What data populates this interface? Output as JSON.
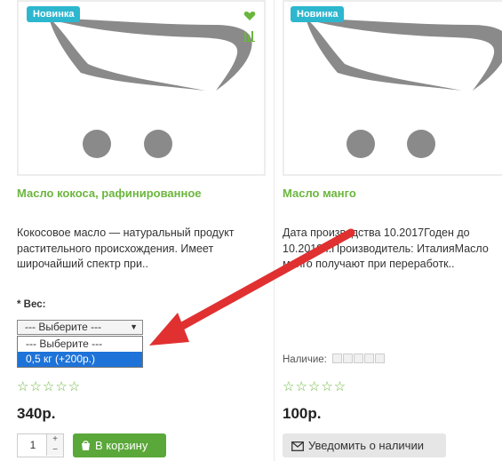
{
  "colors": {
    "accent": "#6bb63e",
    "badge": "#2db7cf",
    "cart_button": "#5aa839",
    "select_highlight": "#1e73d8",
    "annotation_arrow": "#e03030"
  },
  "products": [
    {
      "badge": "Новинка",
      "title": "Масло кокоса, рафинированное",
      "description": "Кокосовое масло  — натуральный продукт растительного происхождения. Имеет широчайший спектр при..",
      "option_label": "* Вес:",
      "select_value": "--- Выберите ---",
      "options": [
        "--- Выберите ---",
        "0,5 кг (+200р.)"
      ],
      "stars": "☆☆☆☆☆",
      "price": "340р.",
      "quantity": "1",
      "qty_up": "+",
      "qty_down": "−",
      "cart_label": "В корзину",
      "icons": [
        "heart-icon",
        "bar-chart-icon",
        "cart-icon"
      ]
    },
    {
      "badge": "Новинка",
      "title": "Масло манго",
      "description": "Дата производства 10.2017Годен до 10.2019 г.Производитель: ИталияМасло манго получают при переработк..",
      "availability_label": "Наличие:",
      "stars": "☆☆☆☆☆",
      "price": "100р.",
      "notify_label": "Уведомить о наличии",
      "icons": [
        "envelope-icon"
      ]
    }
  ]
}
